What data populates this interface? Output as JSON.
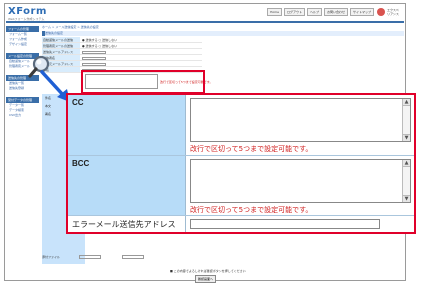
{
  "app": {
    "logo": "XForm",
    "logo_sub": "Webフォーム作成システム",
    "brand_text": "エクスペ\nリアンス",
    "nav": [
      "Home",
      "ログアウト",
      "ヘルプ",
      "お問い合わせ",
      "サイトマップ"
    ]
  },
  "sidebar": [
    {
      "head": "フォームの管理",
      "items": [
        "フォーム一覧",
        "フォーム作成",
        "デザイン設定"
      ]
    },
    {
      "head": "メール設定の管理",
      "items": [
        "自動返信メール",
        "管理者宛メール"
      ]
    },
    {
      "head": "送信先の管理",
      "items": [
        "送信先一覧",
        "送信先登録"
      ]
    },
    {
      "head": "受付データの管理",
      "items": [
        "データ一覧",
        "データ検索",
        "CSV出力"
      ]
    }
  ],
  "breadcrumb": "ホーム > メール送信設定 > 送信先の設定",
  "section_title": "送信先の設定",
  "mini_form": [
    {
      "label": "自動返信メールの送信",
      "value": "● 送信する  ○ 送信しない"
    },
    {
      "label": "管理者宛メールの送信",
      "value": "● 送信する  ○ 送信しない"
    },
    {
      "label": "送信先メールアドレス",
      "value": ""
    },
    {
      "label": "送信者名",
      "value": ""
    },
    {
      "label": "送信元メールアドレス",
      "value": ""
    },
    {
      "label": "件名",
      "value": ""
    }
  ],
  "small_note": "改行で区切って5つまで設定可能です。",
  "blue_rows": [
    "件名",
    "本文",
    "署名"
  ],
  "bottom": {
    "label1": "添付ファイル",
    "label2": "添付",
    "help": "■ この内容でよろしければ確認ボタンを押してください",
    "confirm": "確認画面へ"
  },
  "zoom": {
    "cc_label": "CC",
    "bcc_label": "BCC",
    "note_cc": "改行で区切って5つまで設定可能です。",
    "note_bcc": "改行で区切って5つまで設定可能です。",
    "error_label": "エラーメール送信先アドレス",
    "scroll_up": "▲",
    "scroll_down": "▼"
  },
  "colors": {
    "accent_red": "#e0002a",
    "label_blue": "#b7dcf8",
    "header_blue": "#3a6ea8",
    "note_red": "#d02020"
  },
  "icons": {
    "magnifier": "magnifier-icon",
    "arrow": "arrow-icon"
  }
}
